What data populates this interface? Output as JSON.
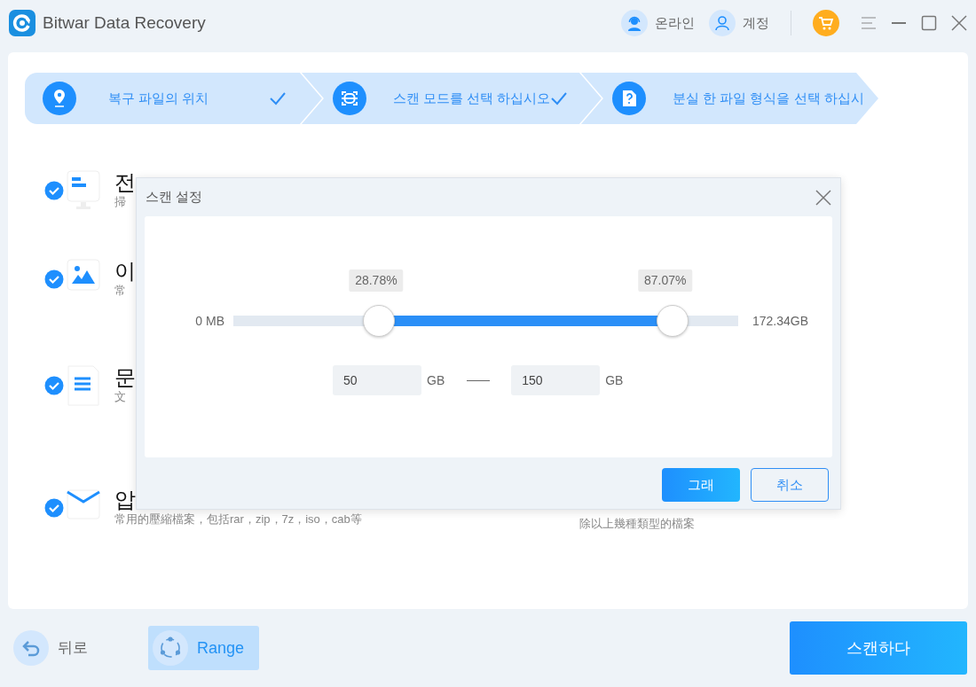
{
  "app": {
    "title": "Bitwar Data Recovery"
  },
  "header": {
    "support": "온라인",
    "account": "계정"
  },
  "steps": [
    {
      "label": "복구 파일의 위치",
      "done": true,
      "kind": "location"
    },
    {
      "label": "스캔 모드를 선택 하십시오",
      "done": true,
      "kind": "scan"
    },
    {
      "label": "분실 한 파일 형식을 선택 하십시",
      "done": false,
      "kind": "type"
    }
  ],
  "categories": [
    {
      "title": "전",
      "description": "掃",
      "checked": true,
      "kind": "all"
    },
    {
      "title": "이",
      "description": "常",
      "checked": true,
      "kind": "image"
    },
    {
      "title": "문",
      "description": "文",
      "checked": true,
      "kind": "document"
    },
    {
      "title": "압",
      "description": "常用的壓縮檔案，包括rar，zip，7z，iso，cab等",
      "checked": true,
      "kind": "archive"
    }
  ],
  "other_description": "除以上幾種類型的檔案",
  "dialog": {
    "title": "스캔 설정",
    "slider": {
      "min_label": "0 MB",
      "max_label": "172.34GB",
      "low": {
        "level": 0.2878,
        "reading": "28.78%"
      },
      "high": {
        "level": 0.8707,
        "reading": "87.07%"
      }
    },
    "from": {
      "value": "50",
      "unit": "GB"
    },
    "to": {
      "value": "150",
      "unit": "GB"
    },
    "buttons": [
      {
        "label": "그래",
        "kind": "primary"
      },
      {
        "label": "취소",
        "kind": "secondary"
      }
    ]
  },
  "footer": {
    "back": "뒤로",
    "range": {
      "label": "Range",
      "selected": true
    },
    "scan": "스캔하다"
  }
}
